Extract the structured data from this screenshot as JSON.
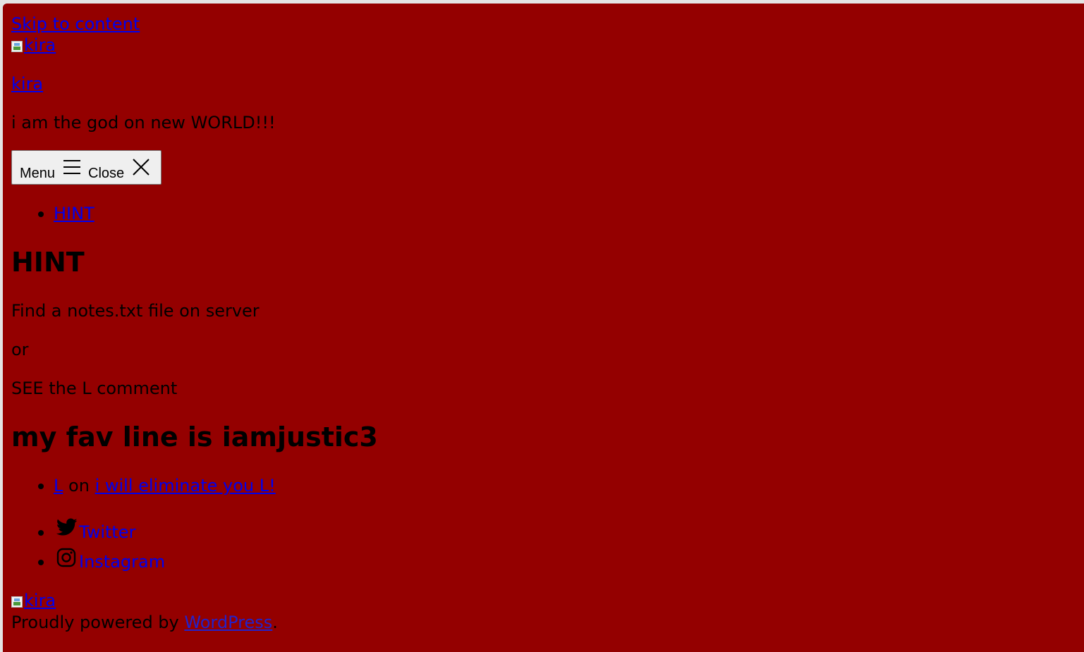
{
  "skip_link": "Skip to content",
  "site": {
    "logo_alt": "kira",
    "title": "kira",
    "tagline": "i am the god on new WORLD!!!"
  },
  "menu_toggle": {
    "menu_label": "Menu",
    "close_label": "Close"
  },
  "nav": {
    "items": [
      {
        "label": "HINT"
      }
    ]
  },
  "post": {
    "title": "HINT",
    "paragraphs": [
      "Find a notes.txt file on server",
      "or",
      "SEE the L comment"
    ]
  },
  "widget": {
    "heading": "my fav line is iamjustic3",
    "recent_comment": {
      "author": "L",
      "connector": "on",
      "post_title": "i will eliminate you L!"
    }
  },
  "social": {
    "items": [
      {
        "label": "Twitter",
        "icon": "twitter-icon"
      },
      {
        "label": "Instagram",
        "icon": "instagram-icon"
      }
    ]
  },
  "footer": {
    "logo_alt": "kira",
    "powered_prefix": "Proudly powered by",
    "powered_link": "WordPress",
    "powered_suffix": "."
  },
  "colors": {
    "page_background": "#940000",
    "link": "#0000ee"
  }
}
